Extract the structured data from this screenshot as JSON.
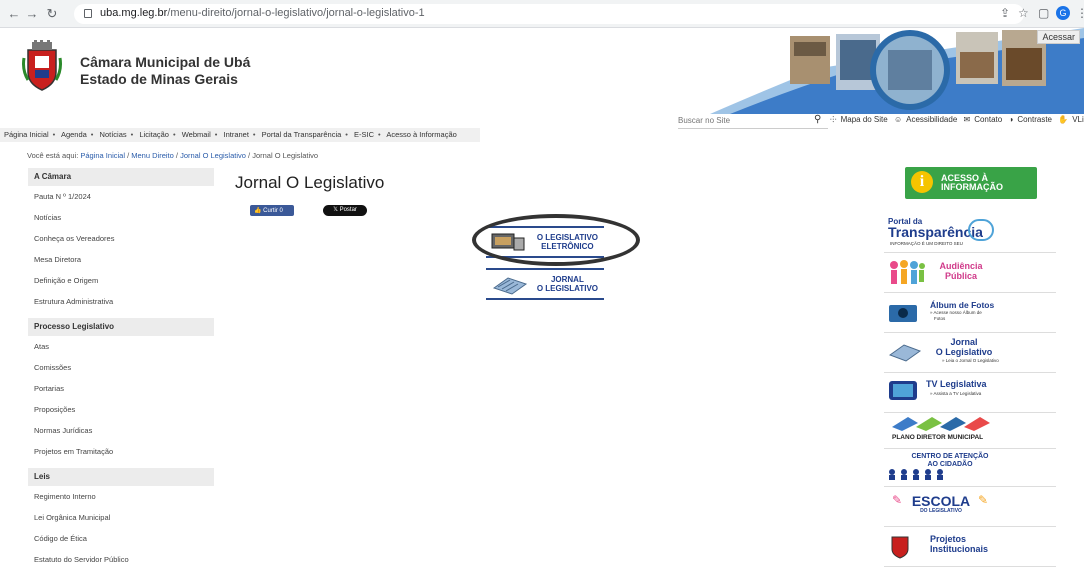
{
  "browser": {
    "url_host": "uba.mg.leg.br",
    "url_path": "/menu-direito/jornal-o-legislativo/jornal-o-legislativo-1"
  },
  "header": {
    "org_line1": "Câmara Municipal de Ubá",
    "org_line2": "Estado de Minas Gerais",
    "acessar": "Acessar"
  },
  "search": {
    "placeholder": "Buscar no Site"
  },
  "utility": [
    "Mapa do Site",
    "Acessibilidade",
    "Contato",
    "Contraste",
    "VLibras"
  ],
  "topnav": [
    "Página Inicial",
    "Agenda",
    "Notícias",
    "Licitação",
    "Webmail",
    "Intranet",
    "Portal da Transparência",
    "E-SIC",
    "Acesso à Informação"
  ],
  "breadcrumb": {
    "prefix": "Você está aqui: ",
    "crumbs": [
      "Página Inicial",
      "Menu Direito",
      "Jornal O Legislativo"
    ],
    "current": "Jornal O Legislativo"
  },
  "sidebar": {
    "sections": [
      {
        "title": "A Câmara",
        "items": [
          "Pauta N º 1/2024",
          "Notícias",
          "Conheça os Vereadores",
          "Mesa Diretora",
          "Definição e Origem",
          "Estrutura Administrativa"
        ]
      },
      {
        "title": "Processo Legislativo",
        "items": [
          "Atas",
          "Comissões",
          "Portarias",
          "Proposições",
          "Normas Jurídicas",
          "Projetos em Tramitação"
        ]
      },
      {
        "title": "Leis",
        "items": [
          "Regimento Interno",
          "Lei Orgânica Municipal",
          "Código de Ética",
          "Estatuto do Servidor Público"
        ]
      }
    ]
  },
  "main": {
    "title": "Jornal O Legislativo",
    "fb_label": "Curtir 0",
    "x_label": "Postar",
    "tiles": [
      {
        "line1": "O LEGISLATIVO",
        "line2": "ELETRÔNICO"
      },
      {
        "line1": "JORNAL",
        "line2": "O LEGISLATIVO"
      }
    ]
  },
  "right": {
    "acesso": {
      "line1": "ACESSO À",
      "line2": "INFORMAÇÃO"
    },
    "portal": {
      "line1": "Portal da",
      "line2": "Transparência",
      "tag": "INFORMAÇÃO É UM DIREITO SEU"
    },
    "audiencia": {
      "line1": "Audiência",
      "line2": "Pública"
    },
    "album": {
      "title": "Álbum de Fotos",
      "sub1": "» Acesse nosso Álbum de",
      "sub2": "Fotos"
    },
    "jornal": {
      "line1": "Jornal",
      "line2": "O Legislativo",
      "sub": "» Leia o Jornal O Legislativo"
    },
    "tv": {
      "title": "TV Legislativa",
      "sub": "» Assista a TV Legislativa"
    },
    "plano": {
      "title": "PLANO DIRETOR MUNICIPAL"
    },
    "centro": {
      "line1": "CENTRO DE ATENÇÃO",
      "line2": "AO CIDADÃO"
    },
    "escola": {
      "line1": "ESCOLA",
      "line2": "DO LEGISLATIVO"
    },
    "projetos": {
      "line1": "Projetos",
      "line2": "Institucionais"
    }
  }
}
